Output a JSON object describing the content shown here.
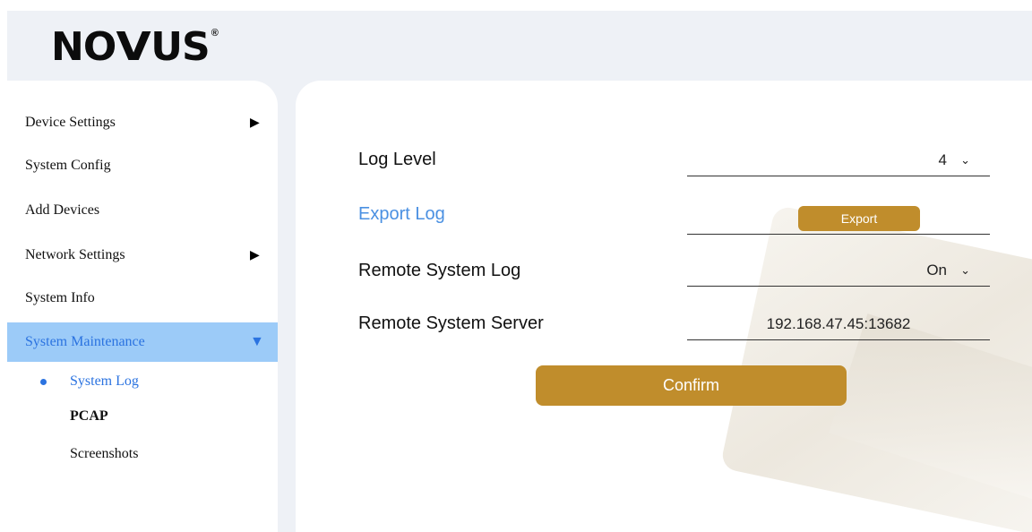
{
  "brand": {
    "logo_text_1": "NO",
    "logo_v": "V",
    "logo_text_2": "US",
    "registered_mark": "®"
  },
  "sidebar": {
    "items": [
      {
        "label": "Device Settings",
        "arrow": "▶"
      },
      {
        "label": "System Config"
      },
      {
        "label": "Add Devices"
      },
      {
        "label": "Network Settings",
        "arrow": "▶"
      },
      {
        "label": "System Info"
      },
      {
        "label": "System Maintenance",
        "arrow": "▼",
        "active": true
      }
    ],
    "sub_items": [
      {
        "label": "System Log",
        "active": true
      },
      {
        "label": "PCAP"
      },
      {
        "label": "Screenshots"
      }
    ]
  },
  "form": {
    "log_level": {
      "label": "Log Level",
      "value": "4"
    },
    "export_log": {
      "label": "Export Log",
      "button": "Export"
    },
    "remote_system_log": {
      "label": "Remote System Log",
      "value": "On"
    },
    "remote_system_server": {
      "label": "Remote System Server",
      "value": "192.168.47.45:13682"
    },
    "confirm_label": "Confirm"
  },
  "colors": {
    "accent_gold": "#c08d2c",
    "active_menu_bg": "#9ccbf8",
    "active_text_blue": "#2b73e0",
    "link_blue": "#4a90e2",
    "background": "#eef1f6"
  },
  "icons": {
    "expand_right": "arrow-right-icon",
    "expanded_down": "arrow-down-icon",
    "dropdown": "chevron-down-icon"
  }
}
